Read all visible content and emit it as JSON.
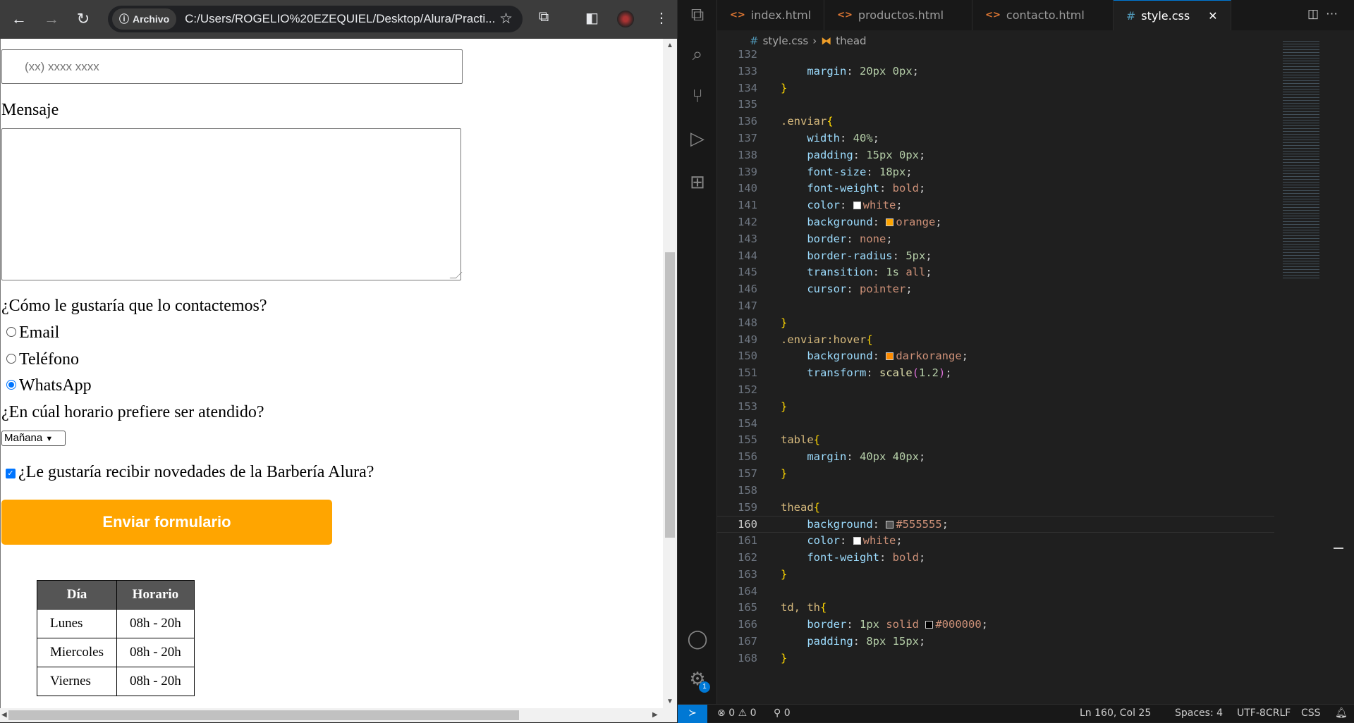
{
  "browser": {
    "address_chip": "Archivo",
    "url": "C:/Users/ROGELIO%20EZEQUIEL/Desktop/Alura/Practi...",
    "page": {
      "phone_placeholder": "(xx) xxxx xxxx",
      "message_label": "Mensaje",
      "contact_question": "¿Cómo le gustaría que lo contactemos?",
      "contact_options": [
        {
          "label": "Email",
          "checked": false
        },
        {
          "label": "Teléfono",
          "checked": false
        },
        {
          "label": "WhatsApp",
          "checked": true
        }
      ],
      "schedule_question": "¿En cúal horario prefiere ser atendido?",
      "schedule_select": "Mañana",
      "newsletter_label": "¿Le gustaría recibir novedades de la Barbería Alura?",
      "newsletter_checked": true,
      "submit_label": "Enviar formulario",
      "button_color": "#ffa500",
      "table": {
        "headers": [
          "Día",
          "Horario"
        ],
        "rows": [
          [
            "Lunes",
            "08h - 20h"
          ],
          [
            "Miercoles",
            "08h - 20h"
          ],
          [
            "Viernes",
            "08h - 20h"
          ]
        ]
      }
    }
  },
  "vscode": {
    "tabs": [
      {
        "label": "index.html",
        "icon": "html"
      },
      {
        "label": "productos.html",
        "icon": "html"
      },
      {
        "label": "contacto.html",
        "icon": "html"
      },
      {
        "label": "style.css",
        "icon": "css",
        "active": true
      }
    ],
    "breadcrumb": [
      "style.css",
      "thead"
    ],
    "current_line": 160,
    "code": [
      {
        "n": 132,
        "t": []
      },
      {
        "n": 133,
        "t": [
          [
            "    ",
            "pl"
          ],
          [
            "margin",
            "prop"
          ],
          [
            ": ",
            "pl"
          ],
          [
            "20px 0px",
            "num"
          ],
          [
            ";",
            "pl"
          ]
        ]
      },
      {
        "n": 134,
        "t": [
          [
            "}",
            "br"
          ]
        ]
      },
      {
        "n": 135,
        "t": []
      },
      {
        "n": 136,
        "t": [
          [
            ".enviar",
            "sel"
          ],
          [
            "{",
            "br"
          ]
        ]
      },
      {
        "n": 137,
        "t": [
          [
            "    ",
            "pl"
          ],
          [
            "width",
            "prop"
          ],
          [
            ": ",
            "pl"
          ],
          [
            "40%",
            "num"
          ],
          [
            ";",
            "pl"
          ]
        ]
      },
      {
        "n": 138,
        "t": [
          [
            "    ",
            "pl"
          ],
          [
            "padding",
            "prop"
          ],
          [
            ": ",
            "pl"
          ],
          [
            "15px 0px",
            "num"
          ],
          [
            ";",
            "pl"
          ]
        ]
      },
      {
        "n": 139,
        "t": [
          [
            "    ",
            "pl"
          ],
          [
            "font-size",
            "prop"
          ],
          [
            ": ",
            "pl"
          ],
          [
            "18px",
            "num"
          ],
          [
            ";",
            "pl"
          ]
        ]
      },
      {
        "n": 140,
        "t": [
          [
            "    ",
            "pl"
          ],
          [
            "font-weight",
            "prop"
          ],
          [
            ": ",
            "pl"
          ],
          [
            "bold",
            "kw"
          ],
          [
            ";",
            "pl"
          ]
        ]
      },
      {
        "n": 141,
        "t": [
          [
            "    ",
            "pl"
          ],
          [
            "color",
            "prop"
          ],
          [
            ": ",
            "pl"
          ],
          [
            "#ffffff",
            "swatch"
          ],
          [
            "white",
            "kw"
          ],
          [
            ";",
            "pl"
          ]
        ]
      },
      {
        "n": 142,
        "t": [
          [
            "    ",
            "pl"
          ],
          [
            "background",
            "prop"
          ],
          [
            ": ",
            "pl"
          ],
          [
            "#ffa500",
            "swatch"
          ],
          [
            "orange",
            "kw"
          ],
          [
            ";",
            "pl"
          ]
        ]
      },
      {
        "n": 143,
        "t": [
          [
            "    ",
            "pl"
          ],
          [
            "border",
            "prop"
          ],
          [
            ": ",
            "pl"
          ],
          [
            "none",
            "kw"
          ],
          [
            ";",
            "pl"
          ]
        ]
      },
      {
        "n": 144,
        "t": [
          [
            "    ",
            "pl"
          ],
          [
            "border-radius",
            "prop"
          ],
          [
            ": ",
            "pl"
          ],
          [
            "5px",
            "num"
          ],
          [
            ";",
            "pl"
          ]
        ]
      },
      {
        "n": 145,
        "t": [
          [
            "    ",
            "pl"
          ],
          [
            "transition",
            "prop"
          ],
          [
            ": ",
            "pl"
          ],
          [
            "1s ",
            "num"
          ],
          [
            "all",
            "kw"
          ],
          [
            ";",
            "pl"
          ]
        ]
      },
      {
        "n": 146,
        "t": [
          [
            "    ",
            "pl"
          ],
          [
            "cursor",
            "prop"
          ],
          [
            ": ",
            "pl"
          ],
          [
            "pointer",
            "kw"
          ],
          [
            ";",
            "pl"
          ]
        ]
      },
      {
        "n": 147,
        "t": []
      },
      {
        "n": 148,
        "t": [
          [
            "}",
            "br"
          ]
        ]
      },
      {
        "n": 149,
        "t": [
          [
            ".enviar:hover",
            "sel"
          ],
          [
            "{",
            "br"
          ]
        ]
      },
      {
        "n": 150,
        "t": [
          [
            "    ",
            "pl"
          ],
          [
            "background",
            "prop"
          ],
          [
            ": ",
            "pl"
          ],
          [
            "#ff8c00",
            "swatch"
          ],
          [
            "darkorange",
            "kw"
          ],
          [
            ";",
            "pl"
          ]
        ]
      },
      {
        "n": 151,
        "t": [
          [
            "    ",
            "pl"
          ],
          [
            "transform",
            "prop"
          ],
          [
            ": ",
            "pl"
          ],
          [
            "scale",
            "fn"
          ],
          [
            "(",
            "br2"
          ],
          [
            "1.2",
            "num"
          ],
          [
            ")",
            "br2"
          ],
          [
            ";",
            "pl"
          ]
        ]
      },
      {
        "n": 152,
        "t": []
      },
      {
        "n": 153,
        "t": [
          [
            "}",
            "br"
          ]
        ]
      },
      {
        "n": 154,
        "t": []
      },
      {
        "n": 155,
        "t": [
          [
            "table",
            "sel"
          ],
          [
            "{",
            "br"
          ]
        ]
      },
      {
        "n": 156,
        "t": [
          [
            "    ",
            "pl"
          ],
          [
            "margin",
            "prop"
          ],
          [
            ": ",
            "pl"
          ],
          [
            "40px 40px",
            "num"
          ],
          [
            ";",
            "pl"
          ]
        ]
      },
      {
        "n": 157,
        "t": [
          [
            "}",
            "br"
          ]
        ]
      },
      {
        "n": 158,
        "t": []
      },
      {
        "n": 159,
        "t": [
          [
            "thead",
            "sel"
          ],
          [
            "{",
            "br"
          ]
        ]
      },
      {
        "n": 160,
        "t": [
          [
            "    ",
            "pl"
          ],
          [
            "background",
            "prop"
          ],
          [
            ": ",
            "pl"
          ],
          [
            "#555555",
            "swatch"
          ],
          [
            "#555555",
            "kw"
          ],
          [
            ";",
            "pl"
          ]
        ]
      },
      {
        "n": 161,
        "t": [
          [
            "    ",
            "pl"
          ],
          [
            "color",
            "prop"
          ],
          [
            ": ",
            "pl"
          ],
          [
            "#ffffff",
            "swatch"
          ],
          [
            "white",
            "kw"
          ],
          [
            ";",
            "pl"
          ]
        ]
      },
      {
        "n": 162,
        "t": [
          [
            "    ",
            "pl"
          ],
          [
            "font-weight",
            "prop"
          ],
          [
            ": ",
            "pl"
          ],
          [
            "bold",
            "kw"
          ],
          [
            ";",
            "pl"
          ]
        ]
      },
      {
        "n": 163,
        "t": [
          [
            "}",
            "br"
          ]
        ]
      },
      {
        "n": 164,
        "t": []
      },
      {
        "n": 165,
        "t": [
          [
            "td, th",
            "sel"
          ],
          [
            "{",
            "br"
          ]
        ]
      },
      {
        "n": 166,
        "t": [
          [
            "    ",
            "pl"
          ],
          [
            "border",
            "prop"
          ],
          [
            ": ",
            "pl"
          ],
          [
            "1px ",
            "num"
          ],
          [
            "solid ",
            "kw"
          ],
          [
            "#000000",
            "swatch"
          ],
          [
            "#000000",
            "kw"
          ],
          [
            ";",
            "pl"
          ]
        ]
      },
      {
        "n": 167,
        "t": [
          [
            "    ",
            "pl"
          ],
          [
            "padding",
            "prop"
          ],
          [
            ": ",
            "pl"
          ],
          [
            "8px 15px",
            "num"
          ],
          [
            ";",
            "pl"
          ]
        ]
      },
      {
        "n": 168,
        "t": [
          [
            "}",
            "br"
          ]
        ]
      }
    ],
    "status": {
      "errors": "0",
      "warnings": "0",
      "ports": "0",
      "position": "Ln 160, Col 25",
      "spaces": "Spaces: 4",
      "encoding": "UTF-8",
      "eol": "CRLF",
      "language": "CSS"
    },
    "accounts_badge": "1"
  }
}
